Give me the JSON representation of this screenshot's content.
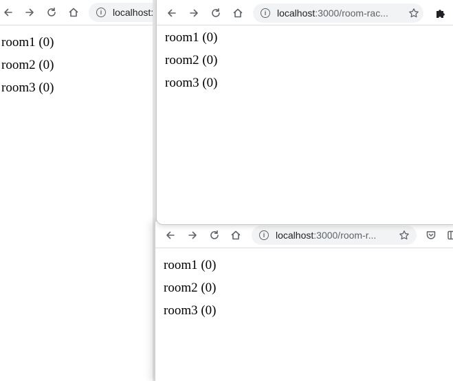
{
  "windows": {
    "left": {
      "url_host": "localhost:",
      "url_path": "",
      "rooms": [
        "room1 (0)",
        "room2 (0)",
        "room3 (0)"
      ]
    },
    "top": {
      "url_host": "localhost",
      "url_path": ":3000/room-rac...",
      "rooms": [
        "room1 (0)",
        "room2 (0)",
        "room3 (0)"
      ]
    },
    "bottom": {
      "url_host": "localhost",
      "url_path": ":3000/room-r...",
      "rooms": [
        "room1 (0)",
        "room2 (0)",
        "room3 (0)"
      ]
    }
  },
  "icons": {
    "back": "arrow-left-icon",
    "forward": "arrow-right-icon",
    "reload": "reload-icon",
    "home": "home-icon",
    "info": "info-icon",
    "bookmark": "star-icon",
    "extension": "puzzle-icon",
    "pocket": "pocket-icon"
  },
  "colors": {
    "address_bar": "#f1f3f4",
    "icon": "#5f6368"
  }
}
